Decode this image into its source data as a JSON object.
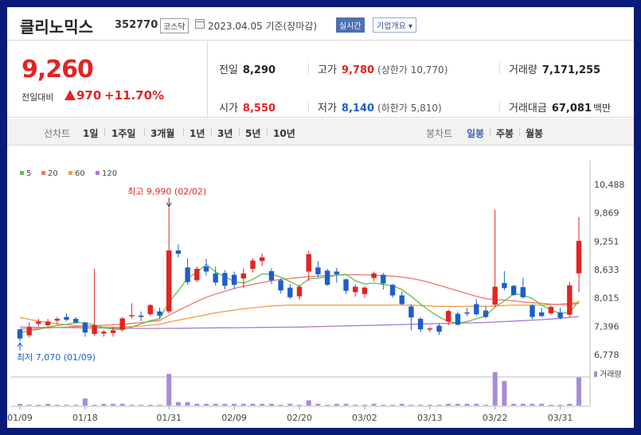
{
  "header": {
    "name": "클리노믹스",
    "code": "352770",
    "market": "코스닥",
    "date": "2023.04.05 기준(장마감)",
    "realtime": "실시간",
    "overview": "기업개요 ▾"
  },
  "quote": {
    "price": "9,260",
    "change_label": "전일대비",
    "change": "970",
    "change_pct": "+11.70%",
    "prev_label": "전일",
    "prev": "8,290",
    "open_label": "시가",
    "open": "8,550",
    "high_label": "고가",
    "high": "9,780",
    "upper_label": "(상한가",
    "upper": "10,770",
    "upper_close": ")",
    "low_label": "저가",
    "low": "8,140",
    "lower_label": "(하한가",
    "lower": "5,810",
    "lower_close": ")",
    "volume_label": "거래량",
    "volume": "7,171,255",
    "amount_label": "거래대금",
    "amount": "67,081",
    "amount_unit": "백만"
  },
  "tabs": {
    "line_label": "선차트",
    "periods": [
      "1일",
      "1주일",
      "3개월",
      "1년",
      "3년",
      "5년",
      "10년"
    ],
    "candle_label": "봉차트",
    "candle_types": [
      "일봉",
      "주봉",
      "월봉"
    ]
  },
  "colors": {
    "up": "#e32323",
    "down": "#1d5fc9",
    "ma5": "#5dc04a",
    "ma20": "#f07373",
    "ma60": "#f0a040",
    "ma120": "#a77ad6",
    "volume": "#a98ad6"
  },
  "chart_data": {
    "type": "candlestick",
    "legend": [
      {
        "name": "5",
        "color": "#5dc04a"
      },
      {
        "name": "20",
        "color": "#f07373"
      },
      {
        "name": "60",
        "color": "#f0a040"
      },
      {
        "name": "120",
        "color": "#a77ad6"
      }
    ],
    "y_ticks": [
      "10,488",
      "9,869",
      "9,251",
      "8,633",
      "8,015",
      "7,396",
      "6,778"
    ],
    "y_tick_values": [
      10488,
      9869,
      9251,
      8633,
      8015,
      7396,
      6778
    ],
    "ylim": [
      6778,
      10488
    ],
    "x_ticks": [
      "01/09",
      "01/18",
      "01/31",
      "02/09",
      "02/20",
      "03/02",
      "03/13",
      "03/22",
      "03/31"
    ],
    "x_tick_index": [
      0,
      7,
      16,
      23,
      30,
      37,
      44,
      51,
      58
    ],
    "max_annotation": {
      "label": "최고 9,990 (02/02)",
      "index": 16,
      "value": 9990
    },
    "min_annotation": {
      "label": "최저 7,070 (01/09)",
      "index": 0,
      "value": 7070
    },
    "volume_label": "거래량",
    "candles": [
      [
        7330,
        7330,
        7070,
        7130
      ],
      [
        7200,
        7480,
        7150,
        7380
      ],
      [
        7450,
        7560,
        7400,
        7500
      ],
      [
        7420,
        7560,
        7380,
        7500
      ],
      [
        7520,
        7600,
        7440,
        7560
      ],
      [
        7600,
        7680,
        7510,
        7540
      ],
      [
        7560,
        7600,
        7460,
        7480
      ],
      [
        7480,
        7500,
        7170,
        7260
      ],
      [
        7230,
        8650,
        7190,
        7420
      ],
      [
        7240,
        7320,
        7170,
        7280
      ],
      [
        7250,
        7380,
        7170,
        7310
      ],
      [
        7330,
        7600,
        7280,
        7570
      ],
      [
        7630,
        7900,
        7570,
        7640
      ],
      [
        7630,
        7720,
        7510,
        7600
      ],
      [
        7660,
        7880,
        7620,
        7860
      ],
      [
        7720,
        7800,
        7570,
        7630
      ],
      [
        7720,
        9990,
        7680,
        9050
      ],
      [
        9050,
        9180,
        8900,
        8980
      ],
      [
        8680,
        8880,
        8300,
        8360
      ],
      [
        8400,
        8700,
        8360,
        8650
      ],
      [
        8700,
        8870,
        8500,
        8590
      ],
      [
        8550,
        8700,
        8280,
        8350
      ],
      [
        8560,
        8620,
        8200,
        8280
      ],
      [
        8520,
        8590,
        8210,
        8300
      ],
      [
        8440,
        8660,
        8230,
        8550
      ],
      [
        8650,
        8880,
        8570,
        8830
      ],
      [
        8820,
        8980,
        8710,
        8900
      ],
      [
        8600,
        8660,
        8320,
        8400
      ],
      [
        8400,
        8440,
        8110,
        8180
      ],
      [
        8240,
        8320,
        7990,
        8030
      ],
      [
        8050,
        8300,
        7970,
        8260
      ],
      [
        8590,
        9040,
        8380,
        8970
      ],
      [
        8680,
        8820,
        8470,
        8530
      ],
      [
        8610,
        8650,
        8280,
        8300
      ],
      [
        8590,
        8670,
        8350,
        8530
      ],
      [
        8420,
        8440,
        8100,
        8170
      ],
      [
        8140,
        8310,
        8040,
        8260
      ],
      [
        8100,
        8270,
        8020,
        8240
      ],
      [
        8450,
        8590,
        8380,
        8550
      ],
      [
        8520,
        8560,
        8200,
        8330
      ],
      [
        8300,
        8320,
        8020,
        8070
      ],
      [
        8070,
        8160,
        7860,
        7880
      ],
      [
        7830,
        7880,
        7310,
        7590
      ],
      [
        7560,
        7600,
        7270,
        7330
      ],
      [
        7340,
        7380,
        7270,
        7350
      ],
      [
        7410,
        7460,
        7210,
        7280
      ],
      [
        7500,
        7760,
        7420,
        7730
      ],
      [
        7670,
        7720,
        7410,
        7430
      ],
      [
        7700,
        7800,
        7620,
        7680
      ],
      [
        7880,
        7990,
        7630,
        7660
      ],
      [
        7740,
        7840,
        7570,
        7600
      ],
      [
        7870,
        9940,
        7820,
        8260
      ],
      [
        8340,
        8600,
        8180,
        8230
      ],
      [
        8280,
        8300,
        8060,
        8080
      ],
      [
        8250,
        8450,
        8000,
        8030
      ],
      [
        7850,
        7880,
        7550,
        7600
      ],
      [
        7700,
        7800,
        7600,
        7620
      ],
      [
        7680,
        7850,
        7650,
        7820
      ],
      [
        7700,
        7800,
        7550,
        7580
      ],
      [
        7650,
        8360,
        7600,
        8290
      ],
      [
        8550,
        9780,
        8140,
        9260
      ]
    ],
    "volumes": [
      1,
      0,
      0,
      1,
      0,
      0,
      0,
      4,
      0,
      1,
      1,
      1,
      0,
      0,
      0,
      0,
      18,
      2,
      2,
      1,
      1,
      1,
      1,
      1,
      1,
      1,
      1,
      1,
      0,
      1,
      0,
      3,
      1,
      0,
      1,
      1,
      0,
      0,
      1,
      0,
      0,
      1,
      0,
      0,
      0,
      0,
      1,
      1,
      1,
      1,
      0,
      19,
      14,
      1,
      1,
      1,
      1,
      0,
      0,
      1,
      16
    ],
    "ma5": [
      7260,
      7300,
      7330,
      7380,
      7414,
      7436,
      7476,
      7470,
      7430,
      7360,
      7340,
      7320,
      7380,
      7450,
      7520,
      7560,
      7930,
      8170,
      8450,
      8570,
      8750,
      8580,
      8480,
      8370,
      8340,
      8420,
      8540,
      8530,
      8470,
      8370,
      8270,
      8430,
      8450,
      8470,
      8510,
      8530,
      8390,
      8320,
      8340,
      8310,
      8280,
      8200,
      8050,
      7880,
      7730,
      7600,
      7500,
      7470,
      7500,
      7560,
      7620,
      7820,
      7950,
      8100,
      8080,
      8000,
      7860,
      7750,
      7680,
      7700,
      7950
    ],
    "ma20": [
      7340,
      7340,
      7350,
      7360,
      7370,
      7380,
      7390,
      7400,
      7410,
      7420,
      7430,
      7440,
      7460,
      7480,
      7500,
      7520,
      7640,
      7740,
      7840,
      7940,
      8030,
      8100,
      8160,
      8220,
      8270,
      8310,
      8350,
      8390,
      8420,
      8440,
      8460,
      8480,
      8490,
      8500,
      8510,
      8520,
      8520,
      8520,
      8510,
      8500,
      8490,
      8470,
      8440,
      8400,
      8350,
      8290,
      8230,
      8170,
      8110,
      8050,
      8000,
      7980,
      7970,
      7950,
      7930,
      7910,
      7900,
      7880,
      7870,
      7870,
      7900
    ],
    "ma60": [
      7590,
      7550,
      7510,
      7480,
      7450,
      7430,
      7410,
      7400,
      7390,
      7380,
      7380,
      7380,
      7390,
      7400,
      7420,
      7440,
      7490,
      7530,
      7570,
      7610,
      7650,
      7690,
      7720,
      7750,
      7780,
      7800,
      7820,
      7840,
      7850,
      7860,
      7860,
      7860,
      7860,
      7860,
      7860,
      7860,
      7860,
      7860,
      7860,
      7860,
      7860,
      7860,
      7860,
      7850,
      7840,
      7830,
      7830,
      7830,
      7830,
      7830,
      7830,
      7840,
      7850,
      7860,
      7860,
      7860,
      7860,
      7870,
      7880,
      7900,
      7920
    ],
    "ma120": [
      7380,
      7378,
      7375,
      7372,
      7370,
      7368,
      7365,
      7363,
      7360,
      7358,
      7356,
      7354,
      7352,
      7350,
      7350,
      7350,
      7352,
      7354,
      7356,
      7358,
      7360,
      7362,
      7364,
      7366,
      7368,
      7370,
      7372,
      7374,
      7376,
      7378,
      7380,
      7385,
      7390,
      7395,
      7400,
      7405,
      7410,
      7415,
      7420,
      7425,
      7430,
      7435,
      7440,
      7445,
      7450,
      7455,
      7460,
      7465,
      7470,
      7475,
      7480,
      7490,
      7500,
      7510,
      7520,
      7530,
      7540,
      7555,
      7570,
      7590,
      7610
    ]
  }
}
